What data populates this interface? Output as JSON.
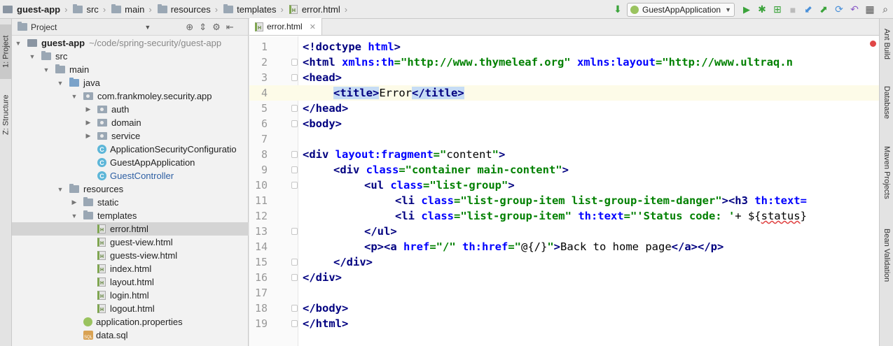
{
  "breadcrumb": [
    {
      "label": "guest-app",
      "icon": "project-icon",
      "bold": true
    },
    {
      "label": "src",
      "icon": "folder-icon"
    },
    {
      "label": "main",
      "icon": "folder-icon"
    },
    {
      "label": "resources",
      "icon": "folder-icon"
    },
    {
      "label": "templates",
      "icon": "folder-icon"
    },
    {
      "label": "error.html",
      "icon": "html-file-icon"
    }
  ],
  "toolbar": {
    "run_config": "GuestAppApplication"
  },
  "left_tabs": [
    "1: Project",
    "Z: Structure"
  ],
  "right_tabs": [
    "Ant Build",
    "Database",
    "Maven Projects",
    "Bean Validation"
  ],
  "project_panel": {
    "title": "Project",
    "root_path": "~/code/spring-security/guest-app",
    "tree": [
      {
        "label": "guest-app",
        "kind": "project",
        "depth": 0,
        "arrow": "open",
        "bold": true
      },
      {
        "label": "src",
        "kind": "folder",
        "depth": 1,
        "arrow": "open"
      },
      {
        "label": "main",
        "kind": "folder",
        "depth": 2,
        "arrow": "open"
      },
      {
        "label": "java",
        "kind": "folder-blue",
        "depth": 3,
        "arrow": "open"
      },
      {
        "label": "com.frankmoley.security.app",
        "kind": "package",
        "depth": 4,
        "arrow": "open"
      },
      {
        "label": "auth",
        "kind": "package",
        "depth": 5,
        "arrow": "closed"
      },
      {
        "label": "domain",
        "kind": "package",
        "depth": 5,
        "arrow": "closed"
      },
      {
        "label": "service",
        "kind": "package",
        "depth": 5,
        "arrow": "closed"
      },
      {
        "label": "ApplicationSecurityConfiguratio",
        "kind": "class",
        "depth": 5,
        "arrow": "none"
      },
      {
        "label": "GuestAppApplication",
        "kind": "class",
        "depth": 5,
        "arrow": "none"
      },
      {
        "label": "GuestController",
        "kind": "class",
        "depth": 5,
        "arrow": "none",
        "blue": true
      },
      {
        "label": "resources",
        "kind": "resources",
        "depth": 3,
        "arrow": "open"
      },
      {
        "label": "static",
        "kind": "folder",
        "depth": 4,
        "arrow": "closed"
      },
      {
        "label": "templates",
        "kind": "folder",
        "depth": 4,
        "arrow": "open"
      },
      {
        "label": "error.html",
        "kind": "html",
        "depth": 5,
        "arrow": "none",
        "selected": true
      },
      {
        "label": "guest-view.html",
        "kind": "html",
        "depth": 5,
        "arrow": "none"
      },
      {
        "label": "guests-view.html",
        "kind": "html",
        "depth": 5,
        "arrow": "none"
      },
      {
        "label": "index.html",
        "kind": "html",
        "depth": 5,
        "arrow": "none"
      },
      {
        "label": "layout.html",
        "kind": "html",
        "depth": 5,
        "arrow": "none"
      },
      {
        "label": "login.html",
        "kind": "html",
        "depth": 5,
        "arrow": "none"
      },
      {
        "label": "logout.html",
        "kind": "html",
        "depth": 5,
        "arrow": "none"
      },
      {
        "label": "application.properties",
        "kind": "properties",
        "depth": 4,
        "arrow": "none"
      },
      {
        "label": "data.sql",
        "kind": "sql",
        "depth": 4,
        "arrow": "none"
      }
    ]
  },
  "editor": {
    "tab_label": "error.html",
    "current_line": 4,
    "lines": [
      {
        "n": "1",
        "fold": false,
        "indent": 0,
        "tokens": [
          [
            "tg",
            "<!doctype "
          ],
          [
            "at",
            "html"
          ],
          [
            "tg",
            ">"
          ]
        ]
      },
      {
        "n": "2",
        "fold": true,
        "indent": 0,
        "tokens": [
          [
            "tg",
            "<html "
          ],
          [
            "at",
            "xmlns:th"
          ],
          [
            "st",
            "=\"http://www.thymeleaf.org\" "
          ],
          [
            "at",
            "xmlns:layout"
          ],
          [
            "st",
            "=\"http://www.ultraq.n"
          ]
        ]
      },
      {
        "n": "3",
        "fold": true,
        "indent": 0,
        "tokens": [
          [
            "tg",
            "<head>"
          ]
        ]
      },
      {
        "n": "4",
        "fold": false,
        "indent": 4,
        "tokens": [
          [
            "tg hl",
            "<title>"
          ],
          [
            "tx",
            "Error"
          ],
          [
            "tg hl",
            "</title>"
          ]
        ]
      },
      {
        "n": "5",
        "fold": true,
        "indent": 0,
        "tokens": [
          [
            "tg",
            "</head>"
          ]
        ]
      },
      {
        "n": "6",
        "fold": true,
        "indent": 0,
        "tokens": [
          [
            "tg",
            "<body>"
          ]
        ]
      },
      {
        "n": "7",
        "fold": false,
        "indent": 0,
        "tokens": []
      },
      {
        "n": "8",
        "fold": true,
        "indent": 0,
        "tokens": [
          [
            "tg",
            "<div "
          ],
          [
            "at",
            "layout:fragment"
          ],
          [
            "st",
            "=\""
          ],
          [
            "tx",
            "content"
          ],
          [
            "st",
            "\""
          ],
          [
            "tg",
            ">"
          ]
        ]
      },
      {
        "n": "9",
        "fold": true,
        "indent": 4,
        "tokens": [
          [
            "tg",
            "<div "
          ],
          [
            "at",
            "class"
          ],
          [
            "st",
            "=\"container main-content\""
          ],
          [
            "tg",
            ">"
          ]
        ]
      },
      {
        "n": "10",
        "fold": true,
        "indent": 8,
        "tokens": [
          [
            "tg",
            "<ul "
          ],
          [
            "at",
            "class"
          ],
          [
            "st",
            "=\"list-group\""
          ],
          [
            "tg",
            ">"
          ]
        ]
      },
      {
        "n": "11",
        "fold": false,
        "indent": 12,
        "tokens": [
          [
            "tg",
            "<li "
          ],
          [
            "at",
            "class"
          ],
          [
            "st",
            "=\"list-group-item list-group-item-danger\""
          ],
          [
            "tg",
            "><h3 "
          ],
          [
            "at",
            "th:text="
          ]
        ]
      },
      {
        "n": "12",
        "fold": false,
        "indent": 12,
        "tokens": [
          [
            "tg",
            "<li "
          ],
          [
            "at",
            "class"
          ],
          [
            "st",
            "=\"list-group-item\" "
          ],
          [
            "at",
            "th:text"
          ],
          [
            "st",
            "=\"'Status code: '"
          ],
          [
            "tx",
            "+ ${"
          ],
          [
            "tx squig",
            "status"
          ],
          [
            "tx",
            "}"
          ]
        ]
      },
      {
        "n": "13",
        "fold": true,
        "indent": 8,
        "tokens": [
          [
            "tg",
            "</ul>"
          ]
        ]
      },
      {
        "n": "14",
        "fold": false,
        "indent": 8,
        "tokens": [
          [
            "tg",
            "<p><a "
          ],
          [
            "at",
            "href"
          ],
          [
            "st",
            "=\"/\" "
          ],
          [
            "at",
            "th:href"
          ],
          [
            "st",
            "=\""
          ],
          [
            "tx",
            "@{/}"
          ],
          [
            "st",
            "\""
          ],
          [
            "tg",
            ">"
          ],
          [
            "tx",
            "Back to home page"
          ],
          [
            "tg",
            "</a></p>"
          ]
        ]
      },
      {
        "n": "15",
        "fold": true,
        "indent": 4,
        "tokens": [
          [
            "tg",
            "</div>"
          ]
        ]
      },
      {
        "n": "16",
        "fold": true,
        "indent": 0,
        "tokens": [
          [
            "tg",
            "</div>"
          ]
        ]
      },
      {
        "n": "17",
        "fold": false,
        "indent": 0,
        "tokens": []
      },
      {
        "n": "18",
        "fold": true,
        "indent": 0,
        "tokens": [
          [
            "tg",
            "</body>"
          ]
        ]
      },
      {
        "n": "19",
        "fold": true,
        "indent": 0,
        "tokens": [
          [
            "tg",
            "</html>"
          ]
        ]
      }
    ]
  },
  "colors": {
    "tag": "#000080",
    "attribute": "#0000ff",
    "string": "#008000",
    "current_line": "#fdfbe8",
    "tag_match": "#c6dcf5",
    "run_green": "#3aa33a",
    "error_red": "#e04646"
  }
}
